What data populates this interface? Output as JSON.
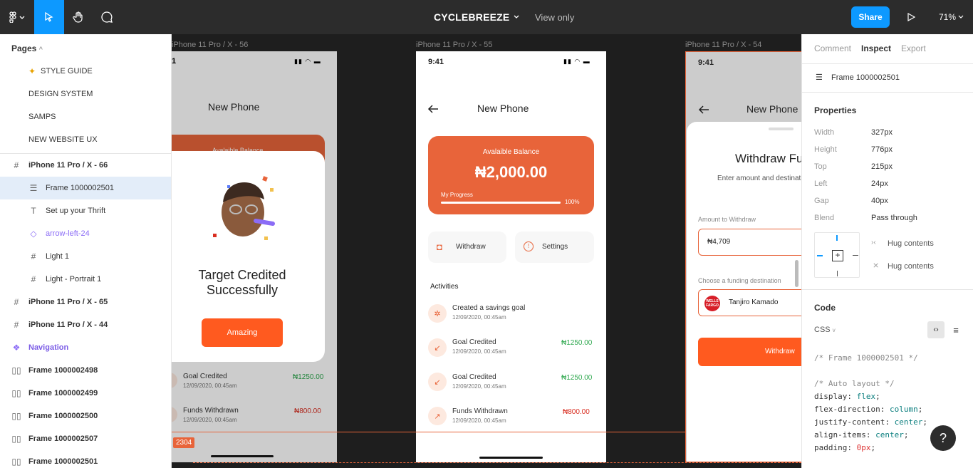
{
  "topbar": {
    "title": "CYCLEBREEZE",
    "view_mode": "View only",
    "share_label": "Share",
    "zoom": "71%"
  },
  "layers": {
    "pages_header": "Pages",
    "pages": [
      "STYLE GUIDE",
      "DESIGN SYSTEM",
      "SAMPS",
      "NEW WEBSITE UX"
    ],
    "items": [
      {
        "label": "iPhone 11 Pro / X - 66",
        "icon": "frame-icon"
      },
      {
        "label": "Frame 1000002501",
        "icon": "autolayout-vertical-icon"
      },
      {
        "label": "Set up your Thrift",
        "icon": "text-icon"
      },
      {
        "label": "arrow-left-24",
        "icon": "component-instance-icon"
      },
      {
        "label": "Light 1",
        "icon": "frame-icon"
      },
      {
        "label": "Light - Portrait 1",
        "icon": "frame-icon"
      },
      {
        "label": "iPhone 11 Pro / X - 65",
        "icon": "frame-icon"
      },
      {
        "label": "iPhone 11 Pro / X - 44",
        "icon": "frame-icon"
      },
      {
        "label": "Navigation",
        "icon": "component-icon"
      },
      {
        "label": "Frame 1000002498",
        "icon": "autolayout-horizontal-icon"
      },
      {
        "label": "Frame 1000002499",
        "icon": "autolayout-horizontal-icon"
      },
      {
        "label": "Frame 1000002500",
        "icon": "autolayout-horizontal-icon"
      },
      {
        "label": "Frame 1000002507",
        "icon": "autolayout-horizontal-icon"
      },
      {
        "label": "Frame 1000002501",
        "icon": "autolayout-horizontal-icon"
      }
    ]
  },
  "canvas": {
    "frame_labels": [
      "iPhone 11 Pro / X - 56",
      "iPhone 11 Pro / X - 55",
      "iPhone 11 Pro / X - 54"
    ],
    "measure_badge": "2304",
    "phone1": {
      "time": "1",
      "title": "New Phone",
      "balance_peek": "Avalaible Balance",
      "modal_title": "Target Credited\nSuccessfully",
      "button": "Amazing",
      "activities": [
        {
          "name": "Goal Credited",
          "date": "12/09/2020, 00:45am",
          "amount": "₦1250.00"
        },
        {
          "name": "Funds Withdrawn",
          "date": "12/09/2020, 00:45am",
          "amount": "₦800.00"
        }
      ]
    },
    "phone2": {
      "time": "9:41",
      "title": "New Phone",
      "balance_label": "Avalaible Balance",
      "balance": "₦2,000.00",
      "progress_label": "My Progress",
      "progress_pct": "100%",
      "progress_value": 1.0,
      "action_withdraw": "Withdraw",
      "action_settings": "Settings",
      "activities_header": "Activities",
      "activities": [
        {
          "name": "Created a savings goal",
          "date": "12/09/2020, 00:45am",
          "amount": "",
          "icon": "goal-icon"
        },
        {
          "name": "Goal Credited",
          "date": "12/09/2020, 00:45am",
          "amount": "₦1250.00",
          "icon": "arrow-down-left-icon"
        },
        {
          "name": "Goal Credited",
          "date": "12/09/2020, 00:45am",
          "amount": "₦1250.00",
          "icon": "arrow-down-left-icon"
        },
        {
          "name": "Funds Withdrawn",
          "date": "12/09/2020, 00:45am",
          "amount": "₦800.00",
          "icon": "arrow-up-right-icon"
        }
      ]
    },
    "phone3": {
      "time": "9:41",
      "title": "New Phone",
      "sheet_title": "Withdraw Fu",
      "sheet_subtitle": "Enter amount and destinati",
      "amount_label": "Amount to Withdraw",
      "amount_value": "₦4,709",
      "funding_label": "Choose a funding destination",
      "bank_logo_text": "WELLS FARGO",
      "account_name": "Tanjiro Kamado",
      "button": "Withdraw"
    }
  },
  "inspect": {
    "tabs": [
      "Comment",
      "Inspect",
      "Export"
    ],
    "layer_name": "Frame 1000002501",
    "properties_header": "Properties",
    "properties": [
      {
        "label": "Width",
        "value": "327px"
      },
      {
        "label": "Height",
        "value": "776px"
      },
      {
        "label": "Top",
        "value": "215px"
      },
      {
        "label": "Left",
        "value": "24px"
      },
      {
        "label": "Gap",
        "value": "40px"
      },
      {
        "label": "Blend",
        "value": "Pass through"
      }
    ],
    "hug_h": "Hug contents",
    "hug_v": "Hug contents",
    "code_header": "Code",
    "code_lang": "CSS",
    "code_lines": [
      {
        "t": "/* Frame 1000002501 */",
        "k": "",
        "v": ""
      },
      {
        "t": "/* Auto layout */",
        "k": "",
        "v": ""
      },
      {
        "t": "",
        "k": "display",
        "v": "flex"
      },
      {
        "t": "",
        "k": "flex-direction",
        "v": "column"
      },
      {
        "t": "",
        "k": "justify-content",
        "v": "center"
      },
      {
        "t": "",
        "k": "align-items",
        "v": "center"
      },
      {
        "t": "",
        "k": "padding",
        "v": "0px"
      }
    ]
  },
  "help_label": "?",
  "colors": {
    "accent": "#0d99ff",
    "brand_orange": "#e8643a",
    "canvas": "#1e1e1e",
    "green": "#2fa84f",
    "red": "#d92d20"
  }
}
